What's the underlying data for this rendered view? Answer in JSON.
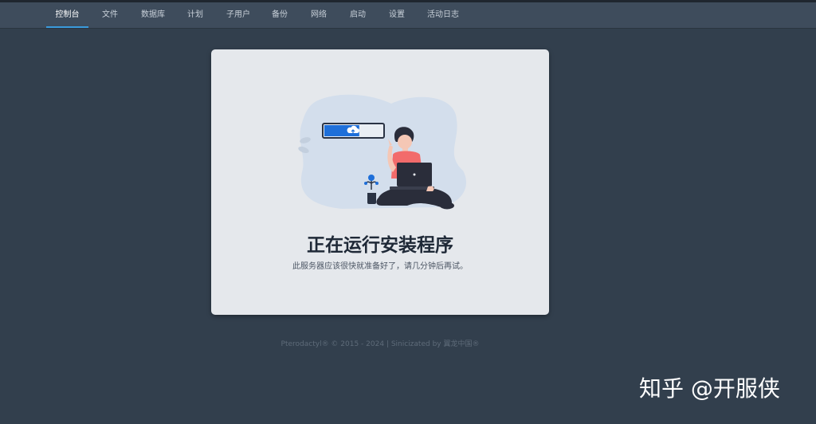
{
  "nav": {
    "items": [
      {
        "label": "控制台",
        "active": true
      },
      {
        "label": "文件",
        "active": false
      },
      {
        "label": "数据库",
        "active": false
      },
      {
        "label": "计划",
        "active": false
      },
      {
        "label": "子用户",
        "active": false
      },
      {
        "label": "备份",
        "active": false
      },
      {
        "label": "网络",
        "active": false
      },
      {
        "label": "启动",
        "active": false
      },
      {
        "label": "设置",
        "active": false
      },
      {
        "label": "活动日志",
        "active": false
      }
    ]
  },
  "card": {
    "title": "正在运行安装程序",
    "subtitle": "此服务器应该很快就准备好了，请几分钟后再试。",
    "illustration": {
      "icon": "cloud-upload-icon",
      "upload_progress": 0.6
    }
  },
  "footer": {
    "text": "Pterodactyl® © 2015 - 2024 | Sinicizated by 翼龙中国®"
  },
  "watermark": {
    "text": "知乎 @开服侠"
  },
  "colors": {
    "background": "#323f4d",
    "navbar": "#3e4c5c",
    "active_underline": "#3a9bdc",
    "card": "#e5e8ec",
    "progress_fill": "#1e6fd9",
    "shirt": "#f26b6b"
  }
}
